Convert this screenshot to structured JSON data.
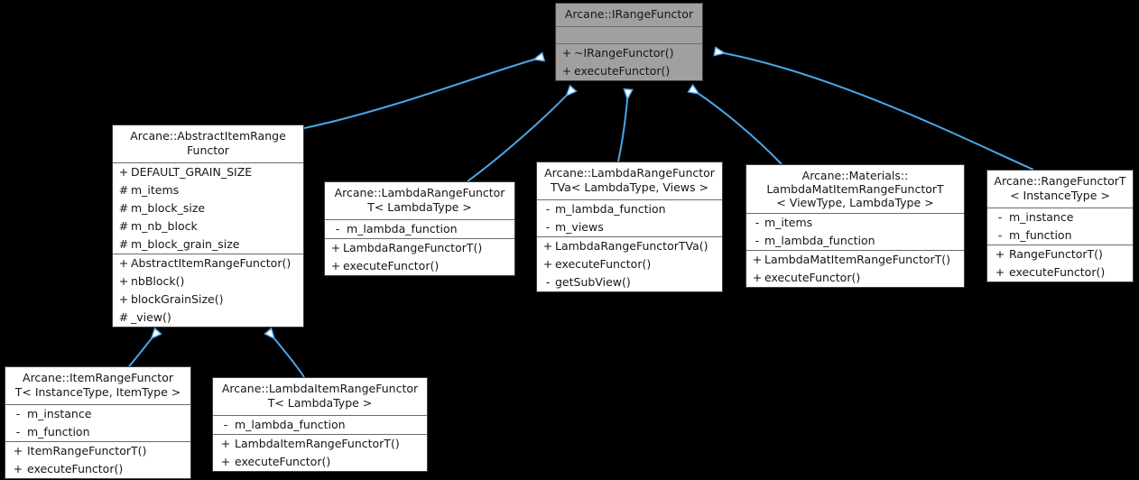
{
  "diagram": {
    "type": "uml-class-inheritance",
    "background_color": "#000000",
    "edge_color": "#4ba6e8",
    "node_fill": "#ffffff",
    "root_node_fill": "#a0a0a0",
    "border_color": "#3d3d3d"
  },
  "nodes": {
    "irangefunctor": {
      "title": "Arcane::IRangeFunctor",
      "attributes": [],
      "methods": [
        {
          "vis": "+",
          "name": "~IRangeFunctor()"
        },
        {
          "vis": "+",
          "name": "executeFunctor()"
        }
      ]
    },
    "abstract_item_range_functor": {
      "title": "Arcane::AbstractItemRange\nFunctor",
      "attributes": [
        {
          "vis": "+",
          "name": "DEFAULT_GRAIN_SIZE"
        },
        {
          "vis": "#",
          "name": "m_items"
        },
        {
          "vis": "#",
          "name": "m_block_size"
        },
        {
          "vis": "#",
          "name": "m_nb_block"
        },
        {
          "vis": "#",
          "name": "m_block_grain_size"
        }
      ],
      "methods": [
        {
          "vis": "+",
          "name": "AbstractItemRangeFunctor()"
        },
        {
          "vis": "+",
          "name": "nbBlock()"
        },
        {
          "vis": "+",
          "name": "blockGrainSize()"
        },
        {
          "vis": "#",
          "name": "_view()"
        }
      ]
    },
    "lambda_range_functor_t": {
      "title": "Arcane::LambdaRangeFunctor\nT< LambdaType >",
      "attributes": [
        {
          "vis": "-",
          "name": "m_lambda_function"
        }
      ],
      "methods": [
        {
          "vis": "+",
          "name": "LambdaRangeFunctorT()"
        },
        {
          "vis": "+",
          "name": "executeFunctor()"
        }
      ]
    },
    "lambda_range_functor_tva": {
      "title": "Arcane::LambdaRangeFunctor\nTVa< LambdaType, Views >",
      "attributes": [
        {
          "vis": "-",
          "name": "m_lambda_function"
        },
        {
          "vis": "-",
          "name": "m_views"
        }
      ],
      "methods": [
        {
          "vis": "+",
          "name": "LambdaRangeFunctorTVa()"
        },
        {
          "vis": "+",
          "name": "executeFunctor()"
        },
        {
          "vis": "-",
          "name": "getSubView()"
        }
      ]
    },
    "lambda_mat_item_range_functor_t": {
      "title": "Arcane::Materials::\nLambdaMatItemRangeFunctorT\n< ViewType, LambdaType >",
      "attributes": [
        {
          "vis": "-",
          "name": "m_items"
        },
        {
          "vis": "-",
          "name": "m_lambda_function"
        }
      ],
      "methods": [
        {
          "vis": "+",
          "name": "LambdaMatItemRangeFunctorT()"
        },
        {
          "vis": "+",
          "name": "executeFunctor()"
        }
      ]
    },
    "range_functor_t": {
      "title": "Arcane::RangeFunctorT\n< InstanceType >",
      "attributes": [
        {
          "vis": "-",
          "name": "m_instance"
        },
        {
          "vis": "-",
          "name": "m_function"
        }
      ],
      "methods": [
        {
          "vis": "+",
          "name": "RangeFunctorT()"
        },
        {
          "vis": "+",
          "name": "executeFunctor()"
        }
      ]
    },
    "item_range_functor_t": {
      "title": "Arcane::ItemRangeFunctor\nT< InstanceType, ItemType >",
      "attributes": [
        {
          "vis": "-",
          "name": "m_instance"
        },
        {
          "vis": "-",
          "name": "m_function"
        }
      ],
      "methods": [
        {
          "vis": "+",
          "name": "ItemRangeFunctorT()"
        },
        {
          "vis": "+",
          "name": "executeFunctor()"
        }
      ]
    },
    "lambda_item_range_functor_t": {
      "title": "Arcane::LambdaItemRangeFunctor\nT< LambdaType >",
      "attributes": [
        {
          "vis": "-",
          "name": "m_lambda_function"
        }
      ],
      "methods": [
        {
          "vis": "+",
          "name": "LambdaItemRangeFunctorT()"
        },
        {
          "vis": "+",
          "name": "executeFunctor()"
        }
      ]
    }
  },
  "edges": [
    {
      "from": "abstract_item_range_functor",
      "to": "irangefunctor",
      "kind": "inheritance"
    },
    {
      "from": "lambda_range_functor_t",
      "to": "irangefunctor",
      "kind": "inheritance"
    },
    {
      "from": "lambda_range_functor_tva",
      "to": "irangefunctor",
      "kind": "inheritance"
    },
    {
      "from": "lambda_mat_item_range_functor_t",
      "to": "irangefunctor",
      "kind": "inheritance"
    },
    {
      "from": "range_functor_t",
      "to": "irangefunctor",
      "kind": "inheritance"
    },
    {
      "from": "item_range_functor_t",
      "to": "abstract_item_range_functor",
      "kind": "inheritance"
    },
    {
      "from": "lambda_item_range_functor_t",
      "to": "abstract_item_range_functor",
      "kind": "inheritance"
    }
  ]
}
